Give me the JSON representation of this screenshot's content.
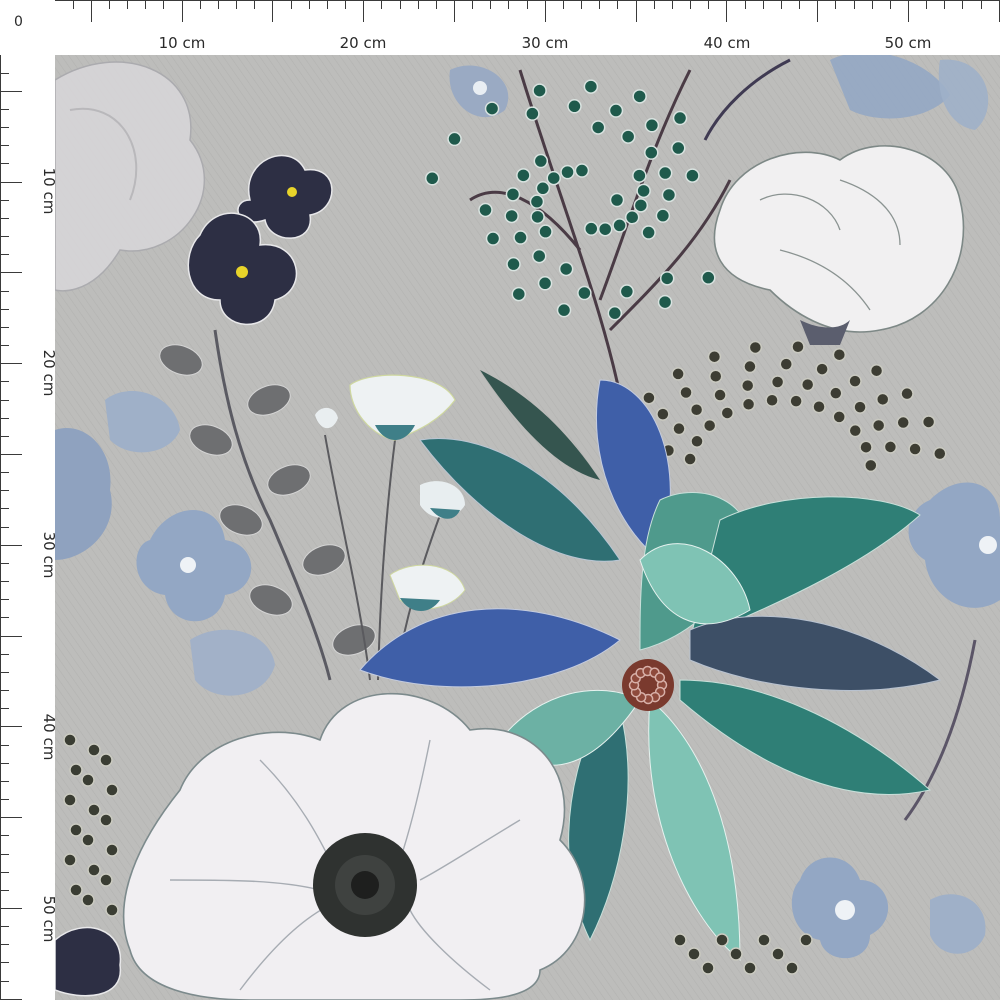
{
  "ruler": {
    "origin_label": "0",
    "top_labels": [
      "10 cm",
      "20 cm",
      "30 cm",
      "40 cm",
      "50 cm"
    ],
    "left_labels": [
      "10 cm",
      "20 cm",
      "30 cm",
      "40 cm",
      "50 cm"
    ]
  },
  "fabric": {
    "background_color": "#bdbdbb",
    "palette": [
      "#2d2f44",
      "#3f5fa8",
      "#3f8c80",
      "#7fc3b4",
      "#f1eff2",
      "#93a7c4",
      "#1f5a4c",
      "#7a3a2e"
    ]
  }
}
